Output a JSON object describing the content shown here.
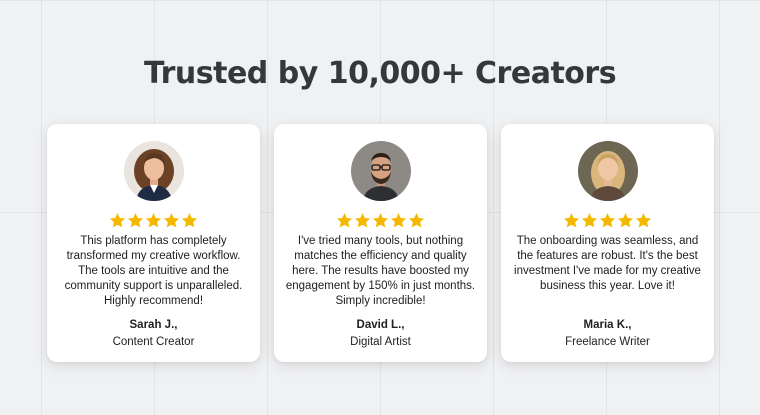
{
  "heading": "Trusted by 10,000+ Creators",
  "star_color": "#f5b800",
  "testimonials": [
    {
      "quote": "This platform has completely transformed my creative workflow. The tools are intuitive and the community support is unparalleled. Highly recommend!",
      "name": "Sarah J.,",
      "role": "Content Creator",
      "rating": 5,
      "avatar": "photo-woman-curly-hair"
    },
    {
      "quote": "I've tried many tools, but nothing matches the efficiency and quality here. The results have boosted my engagement by 150% in just months. Simply incredible!",
      "name": "David L.,",
      "role": "Digital Artist",
      "rating": 5,
      "avatar": "photo-man-glasses-beard"
    },
    {
      "quote": "The onboarding was seamless, and the features are robust. It's the best investment I've made for my creative business this year. Love it!",
      "name": "Maria K.,",
      "role": "Freelance Writer",
      "rating": 5,
      "avatar": "photo-woman-blonde"
    }
  ]
}
